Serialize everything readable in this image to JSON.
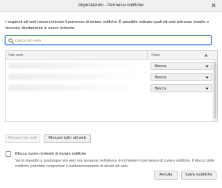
{
  "window": {
    "title": "Impostazioni - Permessi notifiche",
    "close_glyph": "✕"
  },
  "intro": {
    "text": "I seguenti siti web hanno richiesto il permesso di inviare notifiche. È possibile indicare quali siti web potranno inviarle o bloccare direttamente le nuove richieste."
  },
  "search": {
    "placeholder": "Cerca sito web",
    "value": "",
    "icon": "search-icon"
  },
  "table": {
    "columns": {
      "site": "Sito web",
      "status": "Stato"
    },
    "sort_icon": "triangle-up-icon",
    "rows": [
      {
        "site": "",
        "status": "Blocca"
      },
      {
        "site": "",
        "status": "Blocca"
      },
      {
        "site": "",
        "status": "Blocca"
      }
    ]
  },
  "buttons": {
    "remove_site": "Rimuovi sito web",
    "remove_all": "Rimuovi tutti i siti web",
    "cancel": "Annulla",
    "save": "Salva modifiche"
  },
  "block_new": {
    "checked": false,
    "label": "Blocca nuove richieste di inviare notifiche",
    "note": "Verrà impedito a qualunque sito web non presente nell'elenco di richiedere il permesso di inviare notifiche. Il blocco delle notifiche potrebbe comportare il malfunzionamento di alcuni siti web."
  },
  "colors": {
    "accent": "#2d6fd6",
    "button_bg": "#f0f0f0",
    "border": "#c8c8c8",
    "disabled_text": "#a0a0a0"
  }
}
